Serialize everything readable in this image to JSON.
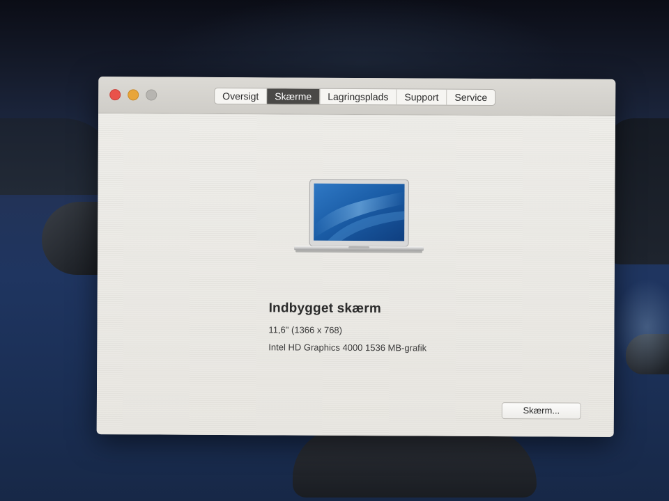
{
  "window": {
    "tabs": [
      {
        "label": "Oversigt",
        "selected": false
      },
      {
        "label": "Skærme",
        "selected": true
      },
      {
        "label": "Lagringsplads",
        "selected": false
      },
      {
        "label": "Support",
        "selected": false
      },
      {
        "label": "Service",
        "selected": false
      }
    ],
    "traffic_lights": {
      "close_color": "#e9524a",
      "minimize_color": "#e8a53a",
      "zoom_color": "#b7b5b1"
    }
  },
  "display": {
    "icon": "macbook-air-icon",
    "name": "Indbygget skærm",
    "size": "11,6\" (1366 x 768)",
    "graphics": "Intel HD Graphics 4000 1536 MB-grafik",
    "button_label": "Skærm..."
  },
  "colors": {
    "selected_tab": "#4a4947",
    "window_background": "#e6e4de"
  }
}
